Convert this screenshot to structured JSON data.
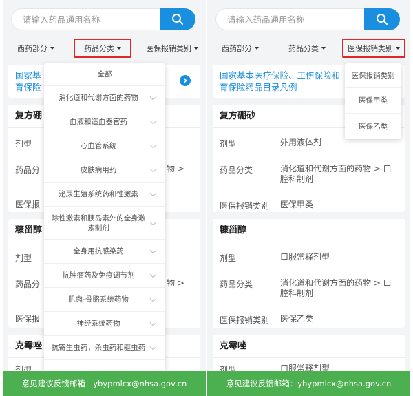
{
  "search": {
    "placeholder": "请输入药品通用名称"
  },
  "filters": {
    "western": "西药部分",
    "category": "药品分类",
    "insurance": "医保报销类别"
  },
  "notice": {
    "line1": "国家基本医疗保险、工伤保险和生育保险药品目录凡例",
    "line1_short": "国家基本医疗保险、工伤保险和",
    "line2": "育保险药品目录凡例",
    "left_line1": "国家基",
    "left_line2": "育保险"
  },
  "labels": {
    "dosage_form": "剂型",
    "drug_category": "药品分类",
    "insurance_type": "医保报销类别",
    "dosage_form_short": "剂型",
    "drug_category_short": "药品分",
    "insurance_type_short": "医保报"
  },
  "drugs": [
    {
      "name": "复方硼砂",
      "name_short": "复方硼",
      "dosage_form": "外用液体剂",
      "category": "消化道和代谢方面的药物 > 口腔科制剂",
      "category_tail": "物 >",
      "insurance": "医保甲类"
    },
    {
      "name": "糠甾醇",
      "name_short": "糠甾醇",
      "dosage_form": "口服常释剂型",
      "category": "消化道和代谢方面的药物 > 口腔科制剂",
      "category_tail": "物 >",
      "insurance": "医保乙类"
    },
    {
      "name": "克霉唑",
      "name_short": "克霉唑",
      "dosage_form": "口服常释剂型",
      "cut_label": "剂型"
    }
  ],
  "category_dropdown": {
    "items": [
      "全部",
      "消化道和代谢方面的药物",
      "血液和造血器官药",
      "心血管系统",
      "皮肤病用药",
      "泌尿生殖系统药和性激素",
      "除性激素和胰岛素外的全身激素制剂",
      "全身用抗感染药",
      "抗肿瘤药及免疫调节剂",
      "肌肉-骨骼系统药物",
      "神经系统药物",
      "抗寄生虫药，杀虫药和驱虫药"
    ]
  },
  "insurance_dropdown": {
    "items": [
      "医保报销类别",
      "医保甲类",
      "医保乙类"
    ]
  },
  "footer": {
    "text": "意见建议反馈邮箱：ybypmlcx@nhsa.gov.cn"
  },
  "colors": {
    "accent": "#1a8fe0",
    "footer": "#4caf50",
    "highlight": "#e02828"
  }
}
